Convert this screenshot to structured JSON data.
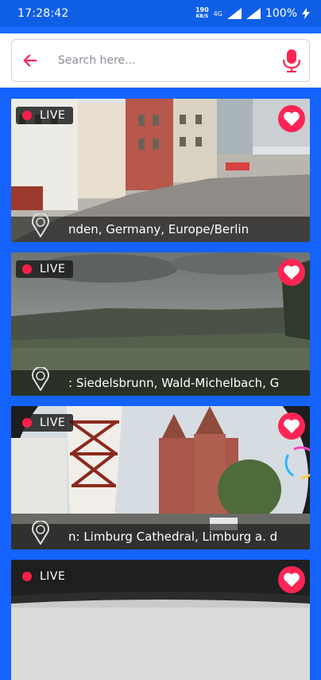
{
  "status_bar": {
    "time": "17:28:42",
    "net_speed_value": "190",
    "net_speed_unit": "KB/S",
    "network": "4G",
    "battery": "100%"
  },
  "search": {
    "placeholder": "Search here..."
  },
  "cams": [
    {
      "live_label": "LIVE",
      "location": "nden, Germany, Europe/Berlin"
    },
    {
      "live_label": "LIVE",
      "location": ": Siedelsbrunn, Wald-Michelbach, G"
    },
    {
      "live_label": "LIVE",
      "location": "n: Limburg Cathedral, Limburg a. d"
    },
    {
      "live_label": "LIVE",
      "location": ""
    }
  ],
  "icons": {
    "back": "arrow-left-icon",
    "mic": "microphone-icon",
    "favorite": "heart-icon",
    "location": "location-pin-icon",
    "live": "live-dot-icon"
  },
  "colors": {
    "background": "#1463ff",
    "accent": "#ff2453",
    "live_dot": "#ff1f48"
  }
}
